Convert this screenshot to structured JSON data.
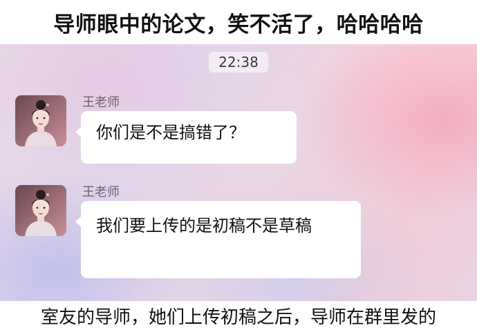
{
  "top_caption": "导师眼中的论文，笑不活了，哈哈哈哈",
  "chat": {
    "timestamp": "22:38",
    "messages": [
      {
        "sender": "王老师",
        "avatar_icon": "profile-photo",
        "text": "你们是不是搞错了？"
      },
      {
        "sender": "王老师",
        "avatar_icon": "profile-photo",
        "text": "我们要上传的是初稿不是草稿"
      }
    ]
  },
  "bottom_caption": "室友的导师，她们上传初稿之后，导师在群里发的",
  "colors": {
    "bubble": "#ffffff",
    "text": "#111111",
    "sender_name": "#6b6470",
    "background_pink": "#f0cdd8",
    "background_lavender": "#e2d4ea"
  }
}
